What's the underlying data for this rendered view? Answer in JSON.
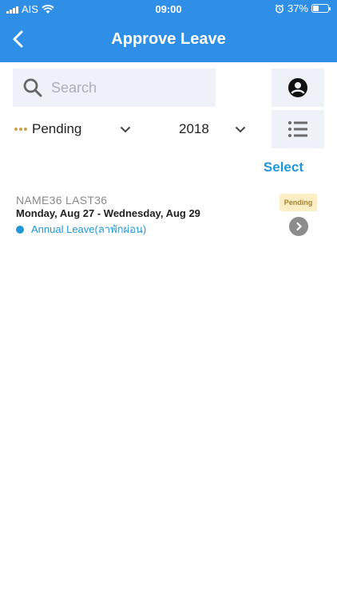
{
  "status_bar": {
    "carrier": "AIS",
    "time": "09:00",
    "battery_percent": "37%",
    "battery_level": 0.37,
    "icons": [
      "signal-icon",
      "wifi-icon",
      "alarm-icon",
      "battery-icon"
    ]
  },
  "header": {
    "title": "Approve Leave",
    "back_icon": "chevron-left-icon",
    "background": "#2f8fe6"
  },
  "search": {
    "placeholder": "Search",
    "value": "",
    "icon": "search-icon"
  },
  "side_buttons": {
    "profile_icon": "user-circle-icon",
    "list_icon": "list-icon"
  },
  "filters": {
    "status": "Pending",
    "status_dot_color": "#c9a44a",
    "year": "2018",
    "dropdown_icon": "chevron-down-icon"
  },
  "select_label": "Select",
  "leaves": [
    {
      "name": "NAME36 LAST36",
      "dates": "Monday, Aug 27 - Wednesday, Aug 29",
      "type": "Annual Leave(ลาพักผ่อน)",
      "type_color": "#2197d9",
      "status": "Pending",
      "status_bg": "#fbedc4",
      "status_fg": "#a4822f"
    }
  ]
}
